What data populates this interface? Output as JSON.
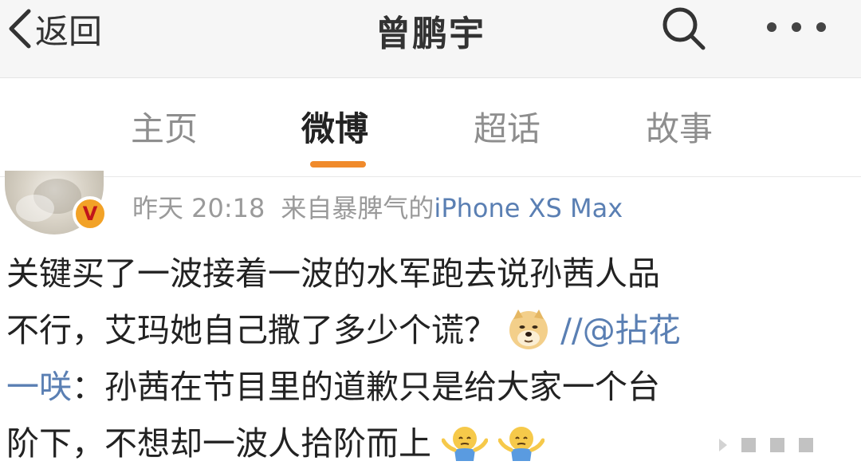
{
  "navbar": {
    "back_label": "返回",
    "title": "曾鹏宇",
    "back_icon": "chevron-left-icon",
    "search_icon": "search-icon",
    "more_icon": "more-dots-icon"
  },
  "tabs": {
    "items": [
      {
        "label": "主页"
      },
      {
        "label": "微博"
      },
      {
        "label": "超话"
      },
      {
        "label": "故事"
      }
    ],
    "active_index": 1,
    "accent_color": "#f08a2b"
  },
  "post": {
    "time": "昨天 20:18",
    "source_prefix": "来自暴脾气的",
    "source_device": "iPhone XS Max",
    "verified_badge": "V",
    "text": {
      "line1": "关键买了一波接着一波的水军跑去说孙茜人品",
      "line2_main": "不行，艾玛她自己撒了多少个谎？",
      "line2_mention": "//@拈花",
      "line3_mention": "一咲",
      "line3_main": "：孙茜在节目里的道歉只是给大家一个台",
      "line4_main": "阶下，不想却一波人拾阶而上"
    },
    "emojis": [
      "doge-emoji",
      "shrug-emoji",
      "shrug-emoji"
    ],
    "link_color": "#5a7fb3"
  }
}
